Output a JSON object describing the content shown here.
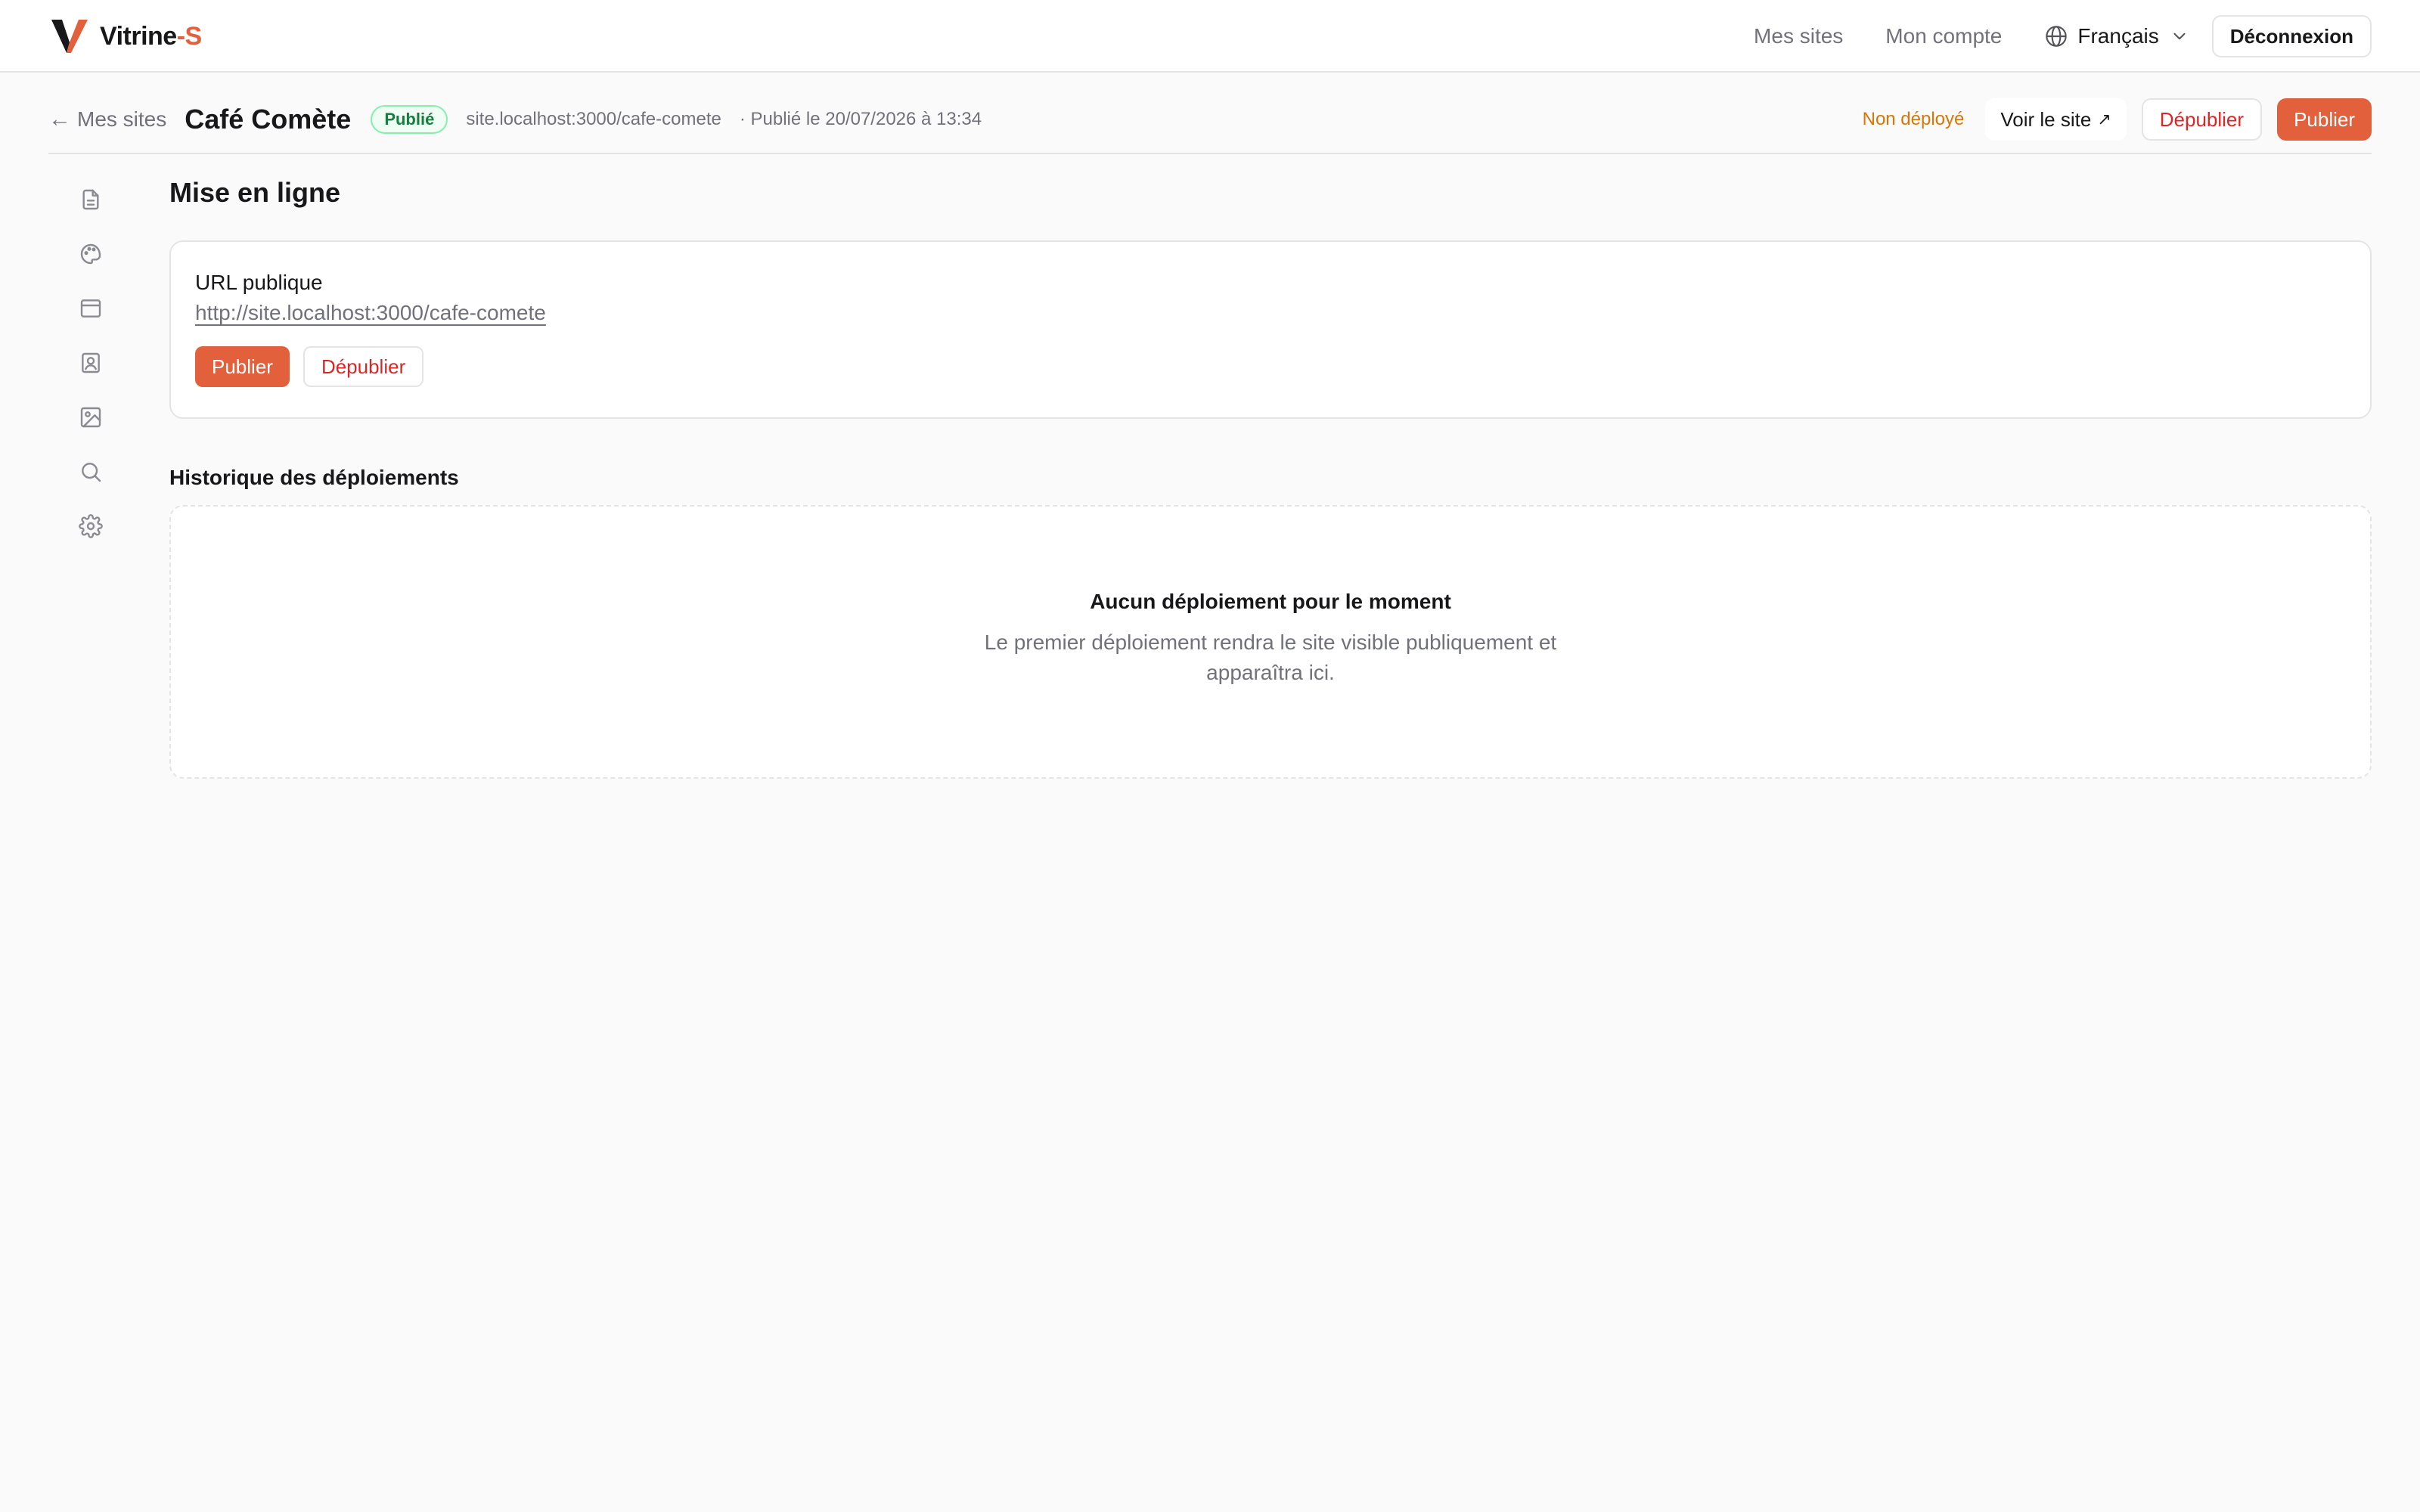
{
  "brand": {
    "name": "Vitrine",
    "suffix": "-S",
    "accent_color": "#e2603b"
  },
  "topnav": {
    "links": [
      "Mes sites",
      "Mon compte"
    ],
    "language": "Français",
    "logout_label": "Déconnexion"
  },
  "site_header": {
    "back_label": "Mes sites",
    "site_name": "Café Comète",
    "status_badge": "Publié",
    "site_url": "site.localhost:3000/cafe-comete",
    "published_info": "· Publié le 20/07/2026 à 13:34",
    "deploy_status": "Non déployé",
    "view_site_label": "Voir le site",
    "unpublish_label": "Dépublier",
    "publish_label": "Publier"
  },
  "rail": {
    "icons": [
      "page-icon",
      "palette-icon",
      "layout-icon",
      "contact-card-icon",
      "image-icon",
      "search-icon",
      "gear-icon"
    ]
  },
  "main": {
    "title": "Mise en ligne",
    "public_url": {
      "label": "URL publique",
      "url": "http://site.localhost:3000/cafe-comete",
      "publish_label": "Publier",
      "unpublish_label": "Dépublier"
    },
    "history": {
      "title": "Historique des déploiements",
      "empty_title": "Aucun déploiement pour le moment",
      "empty_desc": "Le premier déploiement rendra le site visible publiquement et apparaîtra ici."
    }
  },
  "colors": {
    "accent": "#e2603b",
    "danger": "#dc2626",
    "success": "#15803d",
    "warning": "#d97706"
  }
}
